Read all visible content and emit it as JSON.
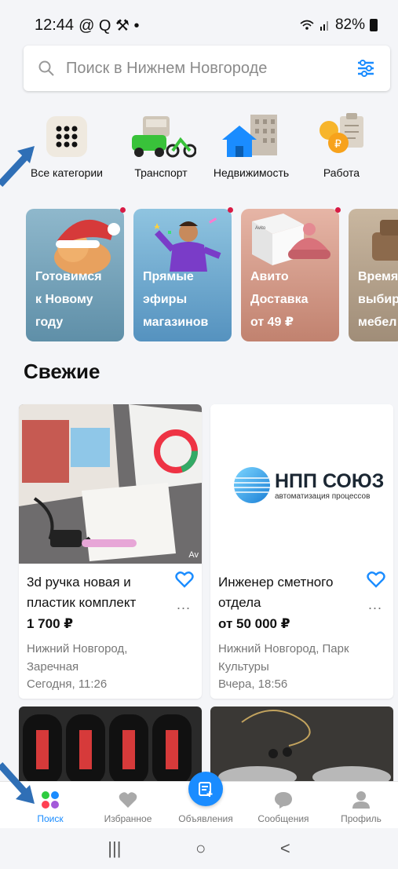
{
  "status_bar": {
    "time": "12:44",
    "indicators": "@ Q ⚒ •",
    "battery": "82%"
  },
  "search": {
    "placeholder": "Поиск в Нижнем Новгороде",
    "icon": "search-icon",
    "filter_icon": "filter-icon"
  },
  "categories": [
    {
      "label": "Все категории",
      "icon": "grid-icon"
    },
    {
      "label": "Транспорт",
      "icon": "vehicles-icon"
    },
    {
      "label": "Недвижимость",
      "icon": "building-icon"
    },
    {
      "label": "Работа",
      "icon": "coins-icon"
    }
  ],
  "stories": [
    {
      "line1": "Готовимся",
      "line2": "к Новому",
      "line3": "году",
      "color": "#6b9bb4"
    },
    {
      "line1": "Прямые",
      "line2": "эфиры",
      "line3": "магазинов",
      "color": "#69a7cf"
    },
    {
      "line1": "Авито",
      "line2": "Доставка",
      "line3": "от 49 ₽",
      "color": "#c98f80"
    },
    {
      "line1": "Время",
      "line2": "выбир",
      "line3": "мебел",
      "color": "#a89782"
    }
  ],
  "section_title": "Свежие",
  "listings": [
    {
      "title_line1": "3d ручка новая и",
      "title_line2": "пластик комплект",
      "price": "1 700 ₽",
      "location_line1": "Нижний Новгород,",
      "location_line2": "Заречная",
      "time": "Сегодня, 11:26",
      "image_badge": "Av"
    },
    {
      "title_line1": "Инженер сметного",
      "title_line2": "отдела",
      "price": "от 50 000 ₽",
      "location_line1": "Нижний Новгород, Парк",
      "location_line2": "Культуры",
      "time": "Вчера, 18:56",
      "logo_name": "НПП СОЮЗ",
      "logo_sub": "автоматизация процессов"
    }
  ],
  "bottom_nav": [
    {
      "label": "Поиск",
      "icon": "search-dots-icon",
      "active": true
    },
    {
      "label": "Избранное",
      "icon": "heart-icon",
      "active": false
    },
    {
      "label": "Объявления",
      "icon": "add-listing-icon",
      "active": false
    },
    {
      "label": "Сообщения",
      "icon": "chat-icon",
      "active": false
    },
    {
      "label": "Профиль",
      "icon": "profile-icon",
      "active": false
    }
  ],
  "system_nav": {
    "recents": "|||",
    "home": "○",
    "back": "<"
  },
  "colors": {
    "accent": "#1a8cff",
    "background": "#f4f5f8",
    "story_dot": "#d81b45"
  }
}
